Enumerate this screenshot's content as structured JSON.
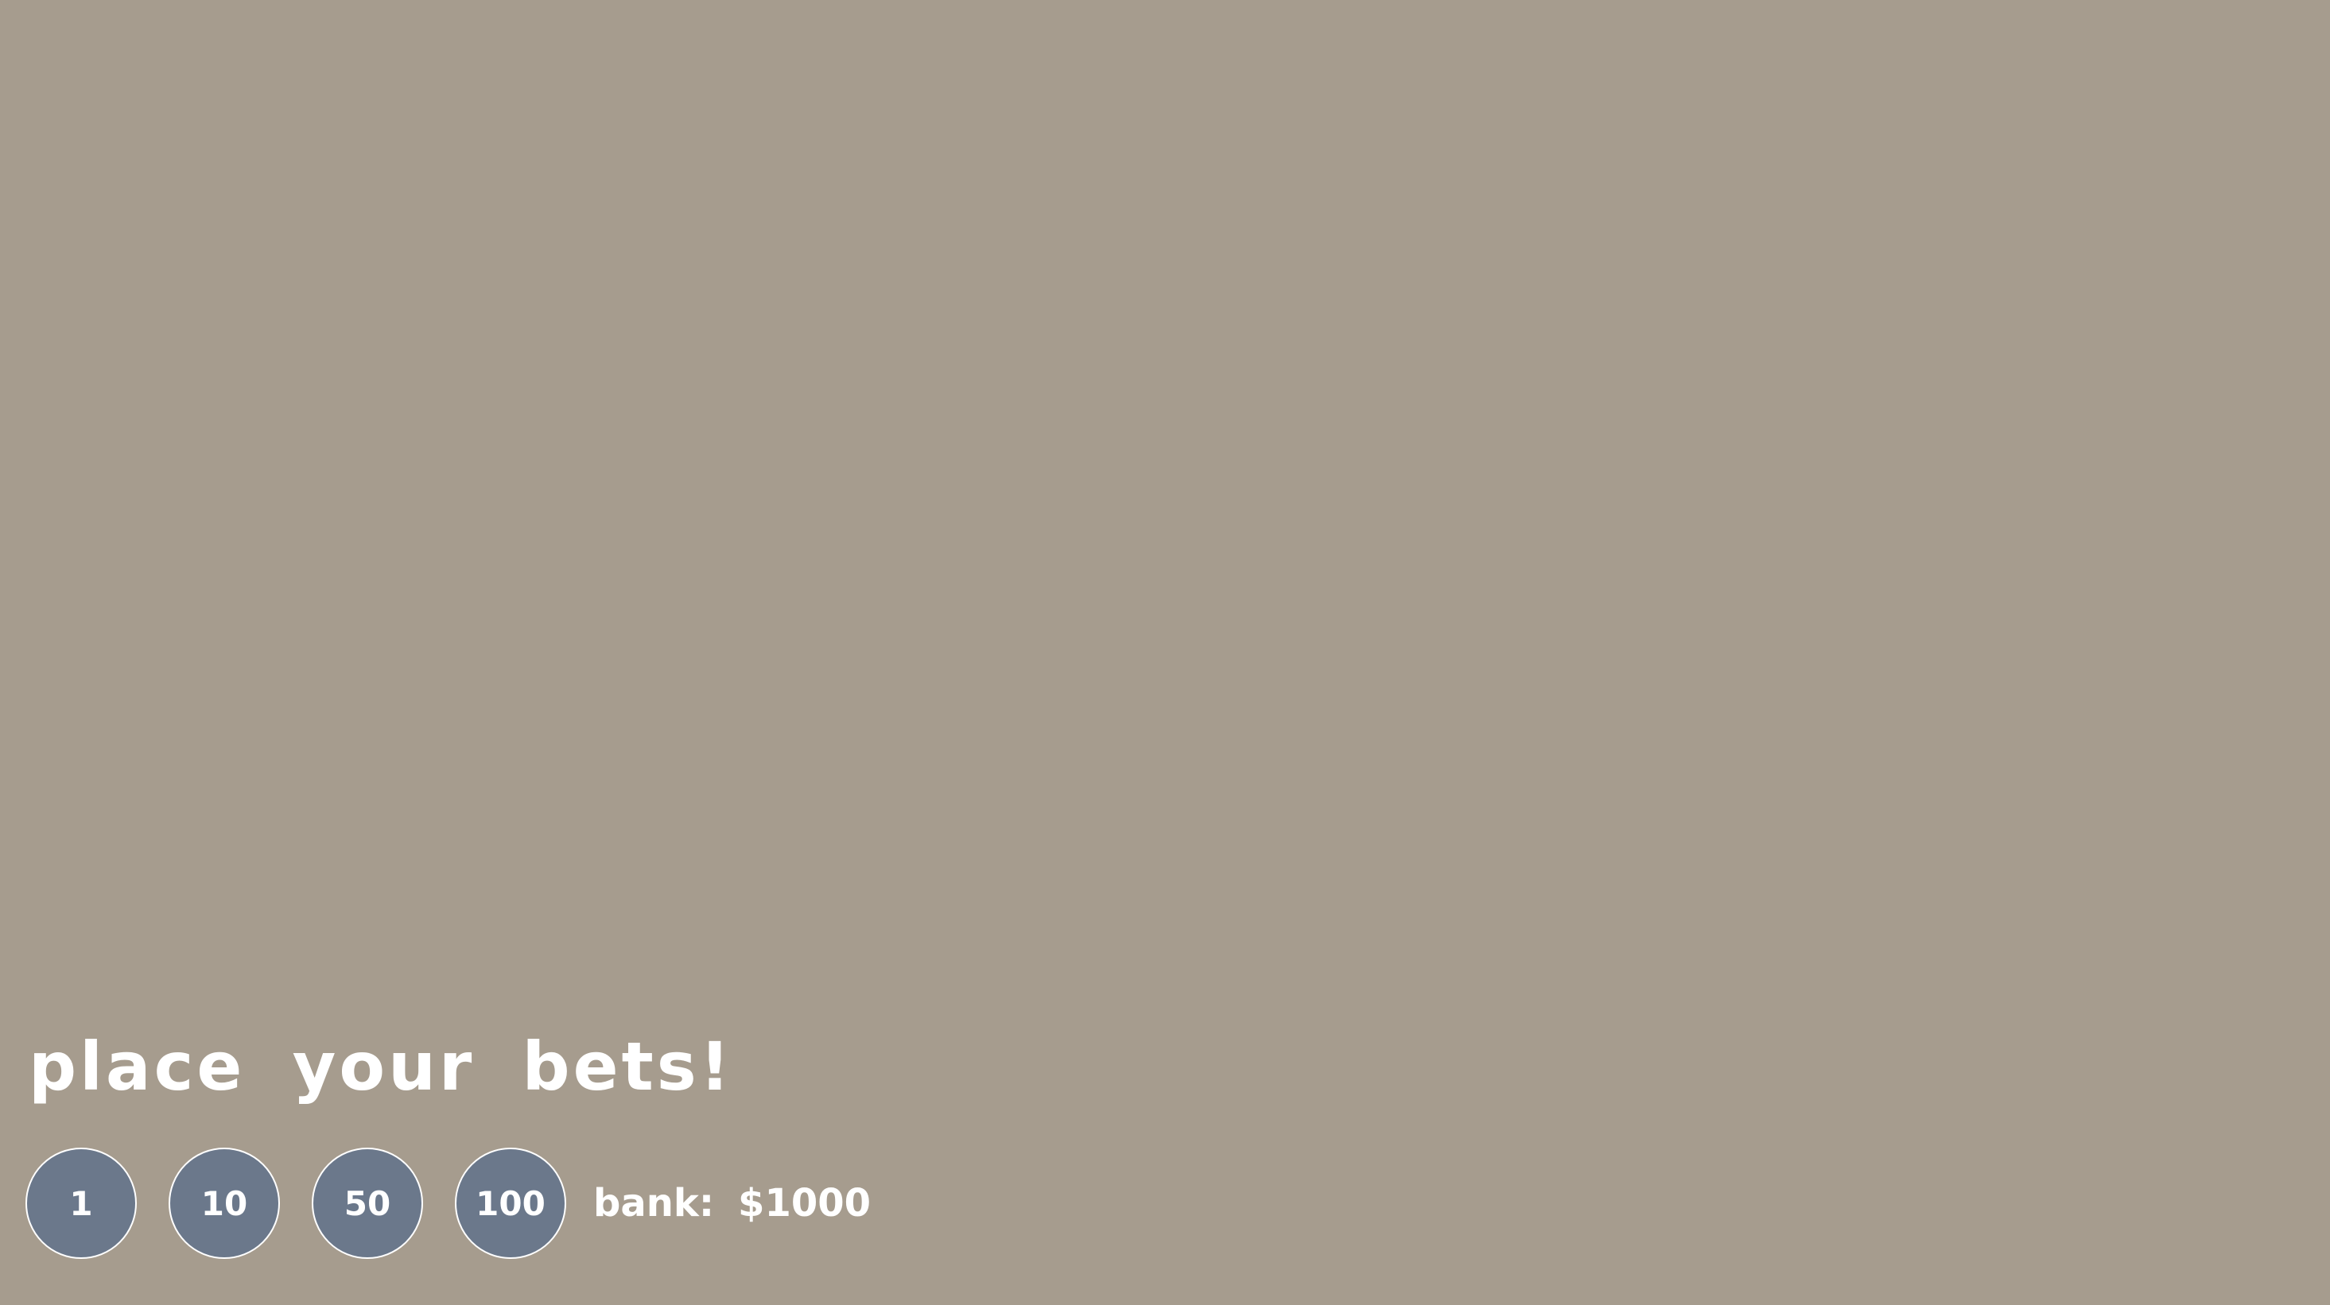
{
  "prompt": "place your bets!",
  "chips": [
    {
      "label": "1"
    },
    {
      "label": "10"
    },
    {
      "label": "50"
    },
    {
      "label": "100"
    }
  ],
  "bank": {
    "label": "bank:",
    "value": "$1000"
  },
  "colors": {
    "background": "#a69c8e",
    "chip_fill": "#6b788b",
    "chip_border": "#ffffff",
    "text": "#ffffff"
  }
}
